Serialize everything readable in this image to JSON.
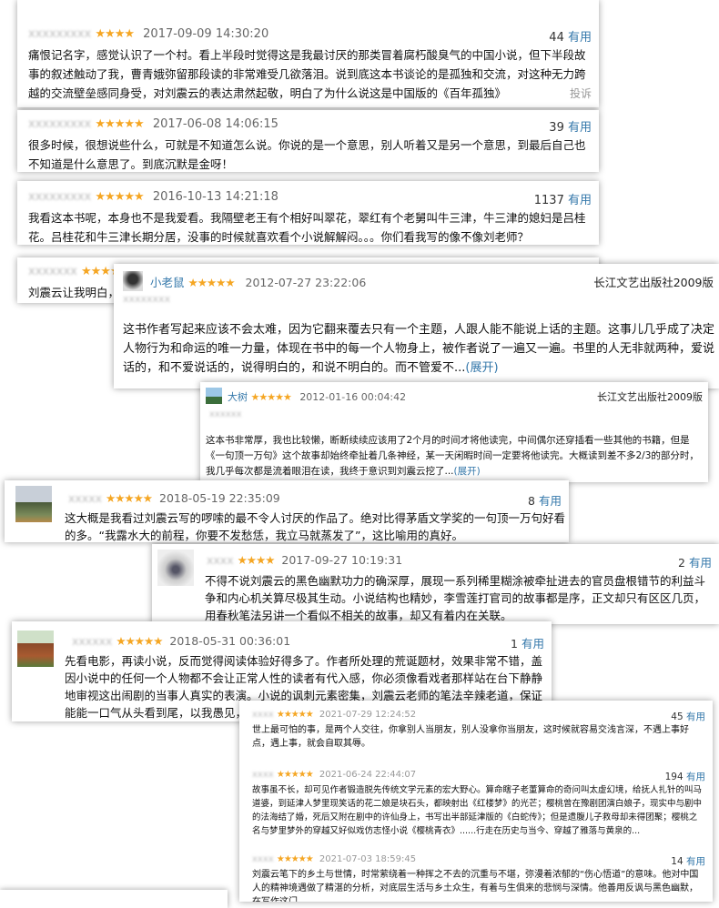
{
  "colors": {
    "link": "#3377aa",
    "star": "#f5a623"
  },
  "reviews": [
    {
      "user": "",
      "stars": "★★★★",
      "date": "2017-09-09 14:30:20",
      "votes": "44",
      "useful": "有用",
      "text": "痛恨记名字，感觉认识了一个村。看上半段时觉得这是我最讨厌的那类冒着腐朽酸臭气的中国小说，但下半段故事的叙述触动了我，曹青娥弥留那段读的非常难受几欲落泪。说到底这本书谈论的是孤独和交流，对这种无力跨越的交流壁垒感同身受，对刘震云的表达肃然起敬，明白了为什么说这是中国版的《百年孤独》",
      "report": "投诉"
    },
    {
      "user": "",
      "stars": "★★★★★",
      "date": "2017-06-08 14:06:15",
      "votes": "39",
      "useful": "有用",
      "text": "很多时候，很想说些什么，可就是不知道怎么说。你说的是一个意思，别人听着又是另一个意思，到最后自己也不知道是什么意思了。到底沉默是金呀！"
    },
    {
      "user": "",
      "stars": "★★★★★",
      "date": "2016-10-13 14:21:18",
      "votes": "1137",
      "useful": "有用",
      "text": "我看这本书呢，本身也不是我爱看。我隔壁老王有个相好叫翠花，翠红有个老舅叫牛三津，牛三津的媳妇是吕桂花。吕桂花和牛三津长期分居，没事的时候就喜欢看个小说解解闷。。。你们看我写的像不像刘老师？"
    },
    {
      "user": "",
      "stars": "★★★★",
      "text": "刘震云让我明白，"
    },
    {
      "user": "小老鼠",
      "stars": "★★★★★",
      "date": "2012-07-27 23:22:06",
      "publisher": "长江文艺出版社2009版",
      "text": "这书作者写起来应该不会太难，因为它翻来覆去只有一个主题，人跟人能不能说上话的主题。这事儿几乎成了决定人物行为和命运的唯一力量，体现在书中的每一个人物身上，被作者说了一遍又一遍。书里的人无非就两种，爱说话的，和不爱说话的，说得明白的，和说不明白的。而不管爱不...",
      "expand": "(展开)"
    },
    {
      "user": "大树",
      "stars": "★★★★★",
      "date": "2012-01-16 00:04:42",
      "publisher": "长江文艺出版社2009版",
      "text": "这本书非常厚，我也比较懒，断断续续应该用了2个月的时间才将他读完，中间偶尔还穿插看一些其他的书籍，但是《一句顶一万句》这个故事却始终牵扯着几条神经，某一天闲暇时间一定要将他读完。大概读到差不多2/3的部分时，我几乎每次都是流着眼泪在读，我终于意识到刘震云挖了...",
      "expand": "(展开)"
    },
    {
      "user": "",
      "stars": "★★★★★",
      "date": "2018-05-19 22:35:09",
      "votes": "8",
      "useful": "有用",
      "text": "这大概是我看过刘震云写的啰嗦的最不令人讨厌的作品了。绝对比得茅盾文学奖的一句顶一万句好看的多。“我露水大的前程，你要不发愁恁，我立马就蒸发了”，这比喻用的真好。"
    },
    {
      "user": "",
      "stars": "★★★★",
      "date": "2017-09-27 10:19:31",
      "votes": "2",
      "useful": "有用",
      "text": "不得不说刘震云的黑色幽默功力的确深厚，展现一系列稀里糊涂被牵扯进去的官员盘根错节的利益斗争和内心机关算尽极其生动。小说结构也精妙，李雪莲打官司的故事都是序，正文却只有区区几页，用春秋笔法另讲一个看似不相关的故事，却又有着内在关联。"
    },
    {
      "user": "",
      "stars": "★★★★★",
      "date": "2018-05-31 00:36:01",
      "votes": "1",
      "useful": "有用",
      "text": "先看电影，再读小说，反而觉得阅读体验好得多了。作者所处理的荒诞题材，效果非常不错，盖因小说中的任何一个人物都不会让正常人性的读者有代入感，你必须像看戏者那样站在台下静静地审视这出闹剧的当事人真实的表演。小说的讽刺元素密集，刘震云老师的笔法辛辣老道，保证能能一口气从头看到尾，以我愚见，这就是一流作品应有的魅力了。"
    },
    {
      "user": "",
      "stars": "★★★★★",
      "date": "2021-07-29 12:24:52",
      "votes": "45",
      "useful": "有用",
      "text": "世上最可怕的事，是两个人交往，你拿别人当朋友，别人没拿你当朋友，这时候就容易交浅言深，不遇上事好点，遇上事，就会自取其辱。"
    },
    {
      "user": "",
      "stars": "★★★★★",
      "date": "2021-06-24 22:44:07",
      "votes": "194",
      "useful": "有用",
      "text": "故事虽不长，却可见作者锻造脱先传统文学元素的宏大野心。算命瞎子老董算命的奇问叫太虚幻境，给抚人扎针的叫马道婆，到延津人梦里现笑话的花二娘是块石头，都映射出《红楼梦》的光芒；樱桃曾在豫剧团演白娘子，现实中与剧中的法海结了婚，死后又附在剧中的许仙身上，书写出半部延津版的《白蛇传》；但是遗腹儿子救母却未得团聚；樱桃之名与梦里梦外的穿越又好似戏仿志怪小说《樱桃青衣》......行走在历史与当今、穿越了雅落与黄泉的..."
    },
    {
      "user": "",
      "stars": "★★★★★",
      "date": "2021-07-03 18:59:45",
      "votes": "14",
      "useful": "有用",
      "text": "刘震云笔下的乡土与世情，时常萦绕着一种挥之不去的沉重与不堪，弥漫着浓郁的“伤心悟道”的意味。他对中国人的精神境遇做了精湛的分析，对底层生活与乡土众生，有着与生俱来的悲悯与深情。他善用反讽与黑色幽默，在写作这门"
    }
  ]
}
